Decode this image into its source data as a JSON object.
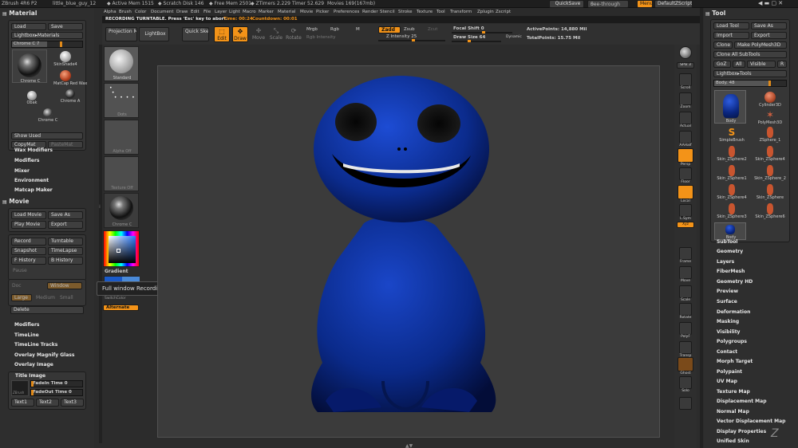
{
  "topbar": {
    "app": "ZBrush 4R6 P2",
    "doc": "little_blue_guy_12",
    "active_mem": "◆ Active Mem 1515",
    "scratch": "◆ Scratch Disk 146",
    "free_mem": "◆ Free Mem 2501",
    "ztimers": "◆ ZTimers 2.229",
    "timer": "Timer 52.629",
    "movies": "Movies 169(167mb)",
    "quicksave": "QuickSave",
    "seethrough": "See-through",
    "seethrough_val": "0",
    "menus": "Menus",
    "script": "DefaultZScript"
  },
  "menubar": [
    "Alpha",
    "Brush",
    "Color",
    "Document",
    "Draw",
    "Edit",
    "File",
    "Layer",
    "Light",
    "Macro",
    "Marker",
    "Material",
    "Movie",
    "Picker",
    "Preferences",
    "Render",
    "Stencil",
    "Stroke",
    "Texture",
    "Tool",
    "Transform",
    "Zplugin",
    "Zscript"
  ],
  "recording_bar": {
    "text": "RECORDING TURNTABLE. Press 'Esc' key to abort.",
    "time_label": "Time: 00:24",
    "countdown": "Countdown: 00:01"
  },
  "toolbar": {
    "projection_master": "Projection Master",
    "lightbox": "LightBox",
    "quick_sketch": "Quick Sketch",
    "edit": "Edit",
    "draw": "Draw",
    "move": "Move",
    "scale": "Scale",
    "rotate": "Rotate",
    "mrgb": "Mrgb",
    "rgb": "Rgb",
    "m": "M",
    "rgb_intensity": "Rgb Intensity",
    "zadd": "Zadd",
    "zsub": "Zsub",
    "zcut": "Zcut",
    "z_intensity": "Z Intensity 25",
    "focal_shift": "Focal Shift 0",
    "draw_size": "Draw Size 64",
    "dynamic": "Dynamic",
    "active_points": "ActivePoints: 14,880 Mil",
    "total_points": "TotalPoints: 15.75 Mil"
  },
  "left_panel": {
    "material_title": "Material",
    "load": "Load",
    "save": "Save",
    "lightbox_materials": "Lightbox▸Materials",
    "chrome_c_slider": "Chrome C 7",
    "materials": [
      "Chrome C",
      "SkinShade4",
      "MatCap Red Wax",
      "Chrome A",
      "Obak",
      "Chrome C"
    ],
    "show_used": "Show Used",
    "copymat": "CopyMat",
    "pastemat": "PasteMat",
    "sections": [
      "Wax Modifiers",
      "Modifiers",
      "Mixer",
      "Environment",
      "Matcap Maker"
    ],
    "movie_title": "Movie",
    "load_movie": "Load Movie",
    "save_as": "Save As",
    "play_movie": "Play Movie",
    "export": "Export",
    "record": "Record",
    "turntable": "Turntable",
    "snapshot": "Snapshot",
    "timelapse": "TimeLapse",
    "f_history": "F History",
    "b_history": "B History",
    "pause": "Pause",
    "doc": "Doc",
    "window": "Window",
    "large": "Large",
    "medium": "Medium",
    "small": "Small",
    "delete": "Delete",
    "movie_sections": [
      "Modifiers",
      "TimeLine",
      "TimeLine Tracks",
      "Overlay Magnify Glass",
      "Overlay Image"
    ],
    "title_image": "Title Image",
    "fadein": "FadeIn Time 0",
    "fadeout": "FadeOut Time 0",
    "text1": "Text1",
    "text2": "Text2",
    "text3": "Text3",
    "logo": "ZBrush"
  },
  "shelf": {
    "standard": "Standard",
    "dots": "Dots",
    "alpha_off": "Alpha Off",
    "texture_off": "Texture Off",
    "chrome_c": "Chrome C",
    "gradient": "Gradient",
    "switchcolor": "SwitchColor",
    "alternate": "Alternate",
    "tooltip": "Full window Recording"
  },
  "right_toolbar": [
    "SPix 3",
    "Scroll",
    "Zoom",
    "Actual",
    "AAHalf",
    "Persp",
    "Floor",
    "Local",
    "L.Sym",
    "Xyz",
    "Frame",
    "Move",
    "Scale",
    "Rotate",
    "PolyF",
    "Transp",
    "Ghost",
    "Solo"
  ],
  "tool_panel": {
    "title": "Tool",
    "load_tool": "Load Tool",
    "save_as": "Save As",
    "import": "Import",
    "export": "Export",
    "clone": "Clone",
    "make_polymesh": "Make PolyMesh3D",
    "clone_all": "Clone All SubTools",
    "goz": "GoZ",
    "all": "All",
    "visible": "Visible",
    "r": "R",
    "lightbox_tools": "Lightbox▸Tools",
    "body_slider": "Body. 48",
    "tools": [
      "Body",
      "Cylinder3D",
      "SimpleBrush",
      "PolyMesh3D",
      "ZSphere_1",
      "Skin_ZSphere2",
      "Skin_ZSphere4",
      "Skin_ZSphere1",
      "Skin_ZSphere_2",
      "Skin_ZSphere4",
      "Skin_ZSphere",
      "Skin_ZSphere3",
      "Skin_ZSphere6",
      "Body"
    ],
    "sections": [
      "SubTool",
      "Geometry",
      "Layers",
      "FiberMesh",
      "Geometry HD",
      "Preview",
      "Surface",
      "Deformation",
      "Masking",
      "Visibility",
      "Polygroups",
      "Contact",
      "Morph Target",
      "Polypaint",
      "UV Map",
      "Texture Map",
      "Displacement Map",
      "Normal Map",
      "Vector Displacement Map",
      "Display Properties",
      "Unified Skin"
    ]
  },
  "colors": {
    "accent": "#f39318",
    "model": "#0c2f8f",
    "background": "#2c2c2c"
  }
}
